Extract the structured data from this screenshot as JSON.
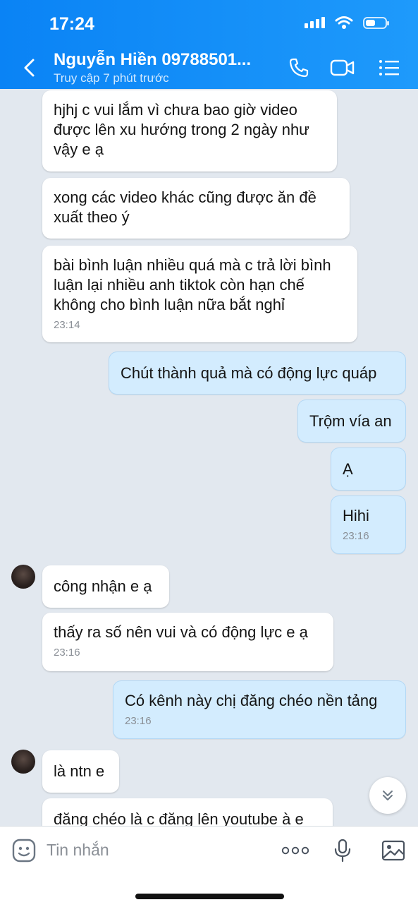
{
  "status_bar": {
    "time": "17:24"
  },
  "header": {
    "contact_name": "Nguyễn Hiền 09788501...",
    "contact_status": "Truy cập 7 phút trước"
  },
  "messages": [
    {
      "side": "in",
      "text": "hjhj c vui lắm vì chưa bao giờ video được lên xu hướng trong 2 ngày như vậy e ạ",
      "time": ""
    },
    {
      "side": "in",
      "text": "xong các video khác cũng được ăn đề xuất theo ý",
      "time": ""
    },
    {
      "side": "in",
      "text": "bài bình luận nhiều quá mà c trả lời bình luận lại nhiều anh tiktok còn hạn chế không cho bình luận nữa bắt nghỉ",
      "time": "23:14"
    },
    {
      "side": "out",
      "text": "Chút thành quả mà có động lực quáp",
      "time": ""
    },
    {
      "side": "out",
      "text": "Trộm vía an",
      "time": ""
    },
    {
      "side": "out",
      "text": "Ạ",
      "time": ""
    },
    {
      "side": "out",
      "text": "Hihi",
      "time": "23:16"
    },
    {
      "side": "in",
      "text": "công nhận e ạ",
      "time": ""
    },
    {
      "side": "in",
      "text": "thấy ra số nên vui và có động lực e ạ",
      "time": "23:16"
    },
    {
      "side": "out",
      "text": "Có kênh này chị đăng chéo nền tảng",
      "time": "23:16"
    },
    {
      "side": "in",
      "text": "là ntn e",
      "time": ""
    },
    {
      "side": "in",
      "text": "đăng chéo là c đăng lên youtube à e",
      "time": ""
    }
  ],
  "input": {
    "placeholder": "Tin nhắn"
  },
  "icons": {
    "back": "chevron-left-icon",
    "call": "phone-icon",
    "video": "video-camera-icon",
    "menu": "list-menu-icon",
    "emoji": "emoji-icon",
    "more": "more-dots-icon",
    "mic": "microphone-icon",
    "image": "image-icon",
    "scroll": "chevron-double-down-icon"
  },
  "colors": {
    "header": "#1a94fa",
    "outgoing_bubble": "#d3ecfe",
    "incoming_bubble": "#ffffff",
    "background": "#e2e8ef"
  }
}
